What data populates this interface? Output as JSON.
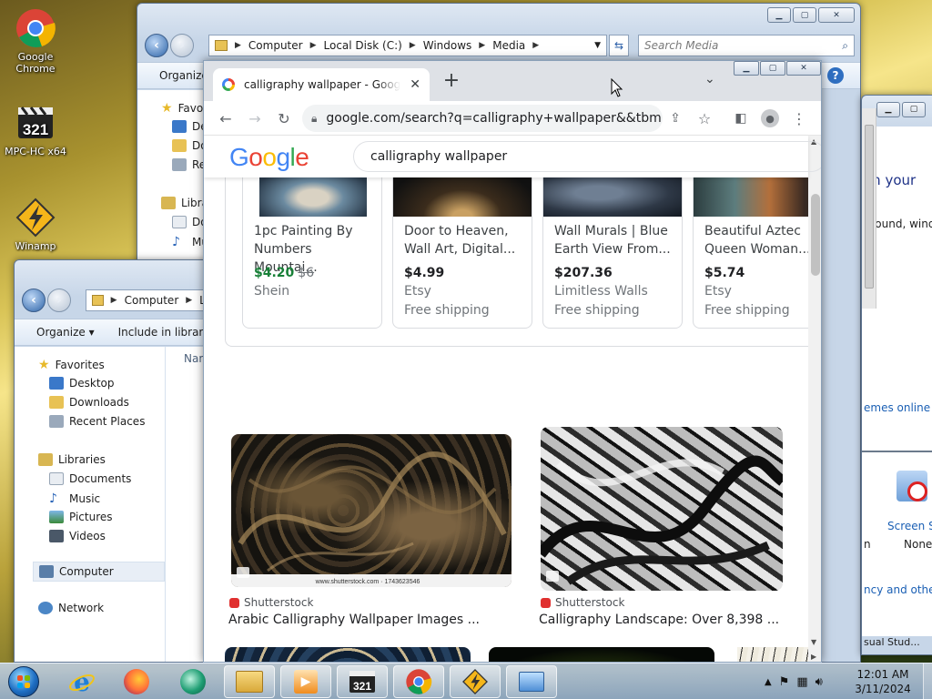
{
  "desktop": {
    "icons": [
      {
        "label": "Google Chrome"
      },
      {
        "label": "MPC-HC x64"
      },
      {
        "label": "Winamp"
      }
    ]
  },
  "explorer_media": {
    "breadcrumb": [
      "Computer",
      "Local Disk (C:)",
      "Windows",
      "Media"
    ],
    "search_placeholder": "Search Media",
    "toolbar": {
      "organize": "Organize"
    },
    "nav": [
      "Favo",
      "De",
      "Do",
      "Re",
      "Libra",
      "Do",
      "Mu",
      "Pi"
    ]
  },
  "explorer_local": {
    "breadcrumb": [
      "Computer",
      "Lo"
    ],
    "toolbar": {
      "organize": "Organize",
      "include": "Include in library"
    },
    "column_header": "Nam",
    "nav": {
      "favorites": "Favorites",
      "desktop": "Desktop",
      "downloads": "Downloads",
      "recent": "Recent Places",
      "libraries": "Libraries",
      "documents": "Documents",
      "music": "Music",
      "pictures": "Pictures",
      "videos": "Videos",
      "computer": "Computer",
      "network": "Network"
    }
  },
  "control_panel": {
    "text1": "on your",
    "text2": "ground, windo",
    "link1": "emes online",
    "item_label": "Screen Sa",
    "item_value": "None",
    "side_n": "n",
    "link2": "ncy and other",
    "footer": "sual Stud..."
  },
  "chrome": {
    "tab_title": "calligraphy wallpaper - Google Search",
    "new_tab": "+",
    "url": "google.com/search?q=calligraphy+wallpaper&&tbm=isch",
    "google_logo": [
      "G",
      "o",
      "o",
      "g",
      "l",
      "e"
    ],
    "search_query": "calligraphy wallpaper",
    "shopping": [
      {
        "title": "1pc Painting By Numbers Mountai...",
        "price": "$4.20",
        "old_price": "$6",
        "store": "Shein",
        "shipping": ""
      },
      {
        "title": "Door to Heaven, Wall Art, Digital...",
        "price": "$4.99",
        "old_price": "",
        "store": "Etsy",
        "shipping": "Free shipping"
      },
      {
        "title": "Wall Murals | Blue Earth View From...",
        "price": "$207.36",
        "old_price": "",
        "store": "Limitless Walls",
        "shipping": "Free shipping"
      },
      {
        "title": "Beautiful Aztec Queen Woman...",
        "price": "$5.74",
        "old_price": "",
        "store": "Etsy",
        "shipping": "Free shipping"
      }
    ],
    "images": [
      {
        "source": "Shutterstock",
        "caption": "Arabic Calligraphy Wallpaper Images ...",
        "watermark": "www.shutterstock.com · 1743623546"
      },
      {
        "source": "Shutterstock",
        "caption": "Calligraphy Landscape: Over 8,398 ..."
      }
    ]
  },
  "taskbar": {
    "time": "12:01 AM",
    "date": "3/11/2024"
  },
  "colors": {
    "google_blue": "#4285f4",
    "google_red": "#ea4335",
    "google_yellow": "#fbbc05",
    "google_green": "#34a853",
    "sale_green": "#188038"
  }
}
